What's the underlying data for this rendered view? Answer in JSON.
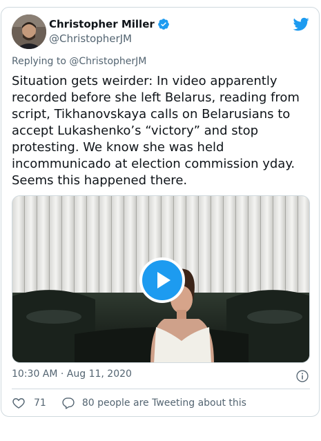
{
  "tweet": {
    "author_name": "Christopher Miller",
    "author_handle": "@ChristopherJM",
    "replying_to_prefix": "Replying to ",
    "replying_to_handle": "@ChristopherJM",
    "text": "Situation gets weirder: In video apparently recorded before she left Belarus, reading from script, Tikhanovskaya calls on Belarusians to accept Lukashenko’s “victory” and stop protesting. We know she was held incommunicado at election commission yday. Seems this happened there.",
    "timestamp": "10:30 AM · Aug 11, 2020",
    "like_count": "71",
    "reply_text": "80 people are Tweeting about this"
  },
  "colors": {
    "accent": "#1d9bf0",
    "text_primary": "#0f1419",
    "text_secondary": "#536471",
    "border": "#cfd9de"
  },
  "icons": {
    "verified": "verified-badge-icon",
    "brand": "twitter-bird-icon",
    "info": "info-icon",
    "like": "heart-icon",
    "reply": "speech-bubble-icon",
    "play": "play-icon"
  }
}
